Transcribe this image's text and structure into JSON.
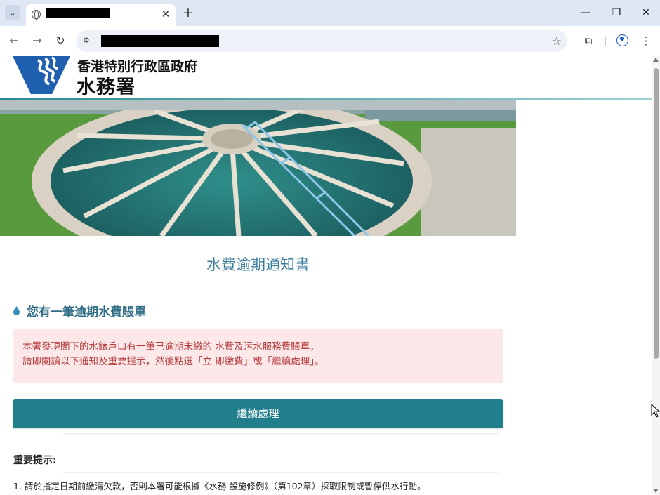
{
  "browser": {
    "tab_close_glyph": "✕",
    "new_tab_glyph": "+",
    "window_controls": {
      "minimize": "—",
      "restore": "❐",
      "close": "✕"
    },
    "nav": {
      "back": "←",
      "forward": "→",
      "reload": "↻"
    },
    "star_glyph": "☆",
    "extensions_glyph": "⧉",
    "menu_glyph": "⋮",
    "icons": [
      "tab-search-icon",
      "globe-icon",
      "site-info-icon",
      "bookmark-star-icon",
      "extensions-icon",
      "profile-icon",
      "menu-icon"
    ]
  },
  "header": {
    "department_line1": "香港特別行政區政府",
    "department_line2": "水務署",
    "accent_color": "#2c8a94"
  },
  "notice": {
    "title": "水費逾期通知書",
    "section_heading": "您有一筆逾期水費賬單",
    "alert_line1": "本署發現閣下的水錶戶口有一筆已逾期未繳的 水費及污水服務費賬單，",
    "alert_line2": "請即閱讀以下通知及重要提示，然後點選「立 即繳費」或「繼續處理」。",
    "continue_button": "繼續處理",
    "tips_heading": "重要提示:",
    "tip_1": "1. 請於指定日期前繳清欠款，否則本署可能根據《水務 設施條例》（第102章）採取限制或暫停供水行動。"
  },
  "colors": {
    "title_blue": "#3a7c9c",
    "heading_teal": "#2f6d86",
    "alert_bg": "#fce8e8",
    "alert_text": "#b63a3a",
    "button_bg": "#207f8a"
  }
}
